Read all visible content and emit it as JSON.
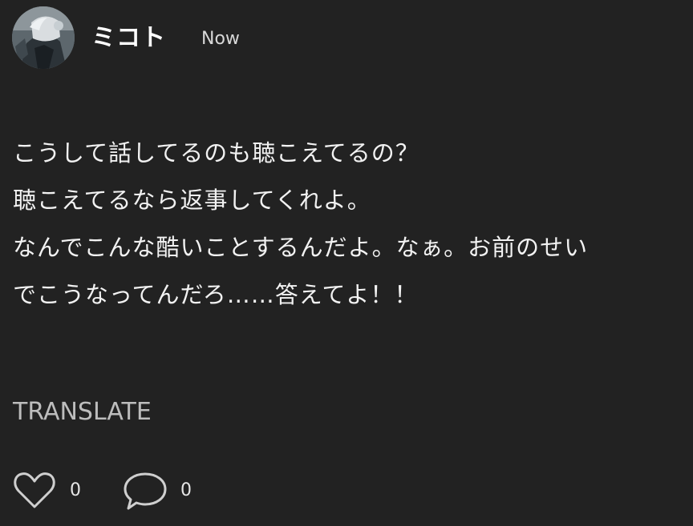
{
  "post": {
    "author": "ミコト",
    "time": "Now",
    "lines": [
      "こうして話してるのも聴こえてるの？",
      "聴こえてるなら返事してくれよ。",
      "なんでこんな酷いことするんだよ。なぁ。お前のせい",
      "でこうなってんだろ……答えてよ！！"
    ],
    "translate_label": "TRANSLATE",
    "like_count": "0",
    "comment_count": "0"
  },
  "icons": {
    "like": "heart-icon",
    "comment": "speech-bubble-icon"
  }
}
